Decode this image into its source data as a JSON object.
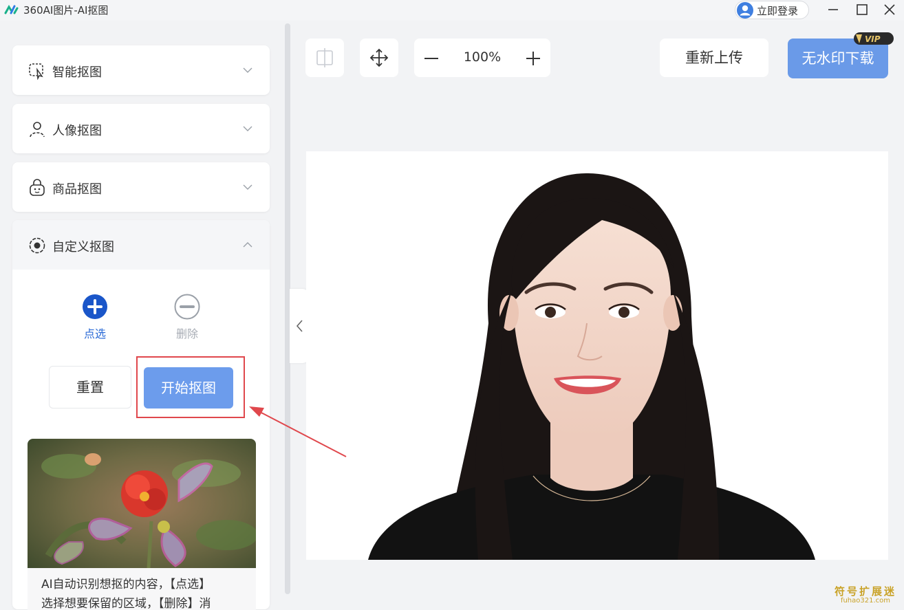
{
  "app": {
    "title": "360AI图片-AI抠图",
    "login_label": "立即登录"
  },
  "sidebar": {
    "sections": [
      {
        "label": "智能抠图",
        "icon": "smart-select-icon",
        "expanded": false
      },
      {
        "label": "人像抠图",
        "icon": "person-icon",
        "expanded": false
      },
      {
        "label": "商品抠图",
        "icon": "product-bag-icon",
        "expanded": false
      },
      {
        "label": "自定义抠图",
        "icon": "target-dot-icon",
        "expanded": true
      }
    ],
    "custom": {
      "add_label": "点选",
      "remove_label": "删除",
      "reset_label": "重置",
      "start_label": "开始抠图",
      "help_text_1": "AI自动识别想抠的内容，【点选】",
      "help_text_2": "选择想要保留的区域，【删除】消"
    }
  },
  "toolbar": {
    "zoom_value": "100%",
    "reupload_label": "重新上传",
    "download_label": "无水印下载",
    "vip_badge": "VIP"
  },
  "watermark": {
    "cn": "符号扩展迷",
    "en": "fuhao321.com"
  },
  "colors": {
    "accent": "#6a9ae8",
    "add_icon": "#1a56c9",
    "highlight": "#e0474c"
  }
}
